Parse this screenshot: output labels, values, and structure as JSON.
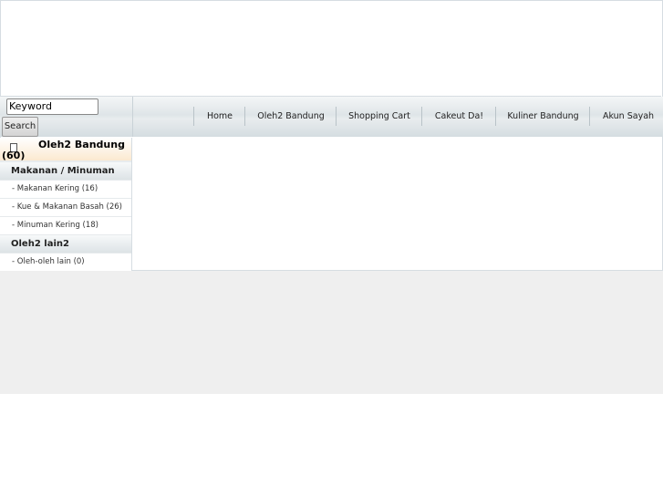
{
  "search": {
    "placeholder": "Keyword",
    "button": "Search"
  },
  "nav": {
    "items": [
      "Home",
      "Oleh2 Bandung",
      "Shopping Cart",
      "Cakeut Da!",
      "Kuliner Bandung",
      "Akun Sayah"
    ]
  },
  "sidebar": {
    "title": "Oleh2 Bandung",
    "count": "(60)",
    "icon": "document-icon",
    "categories": [
      {
        "label": "Makanan / Minuman",
        "items": [
          "- Makanan Kering (16)",
          "- Kue & Makanan Basah (26)",
          "- Minuman Kering (18)"
        ]
      },
      {
        "label": "Oleh2 lain2",
        "items": [
          "- Oleh-oleh lain (0)"
        ]
      }
    ]
  }
}
